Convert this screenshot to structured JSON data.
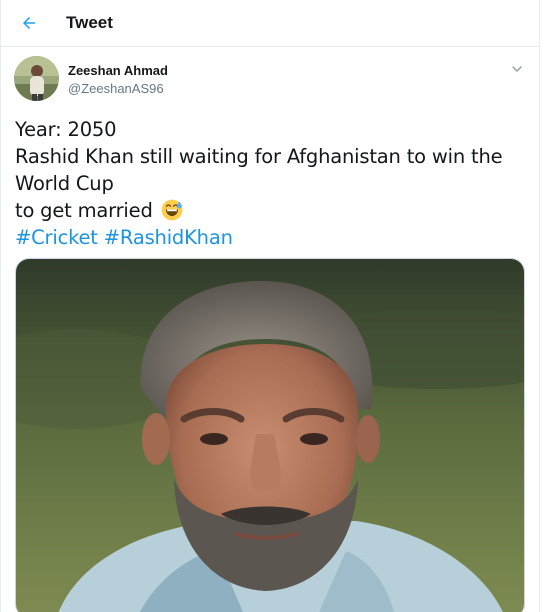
{
  "header": {
    "title": "Tweet",
    "back_icon": "arrow-left-icon",
    "accent_color": "#1da1f2"
  },
  "author": {
    "name": "Zeeshan Ahmad",
    "handle": "@ZeeshanAS96",
    "menu_icon": "chevron-down-icon"
  },
  "tweet": {
    "line1": "Year: 2050",
    "line2": "Rashid Khan still waiting for Afghanistan to win the",
    "line3": "World Cup",
    "line4": "to get married",
    "emoji": "grinning-sweat-emoji",
    "hashtags": [
      "#Cricket",
      "#RashidKhan"
    ],
    "hashtag_color": "#1b95e0"
  },
  "media": {
    "type": "photo",
    "subject": "portrait-photo"
  }
}
